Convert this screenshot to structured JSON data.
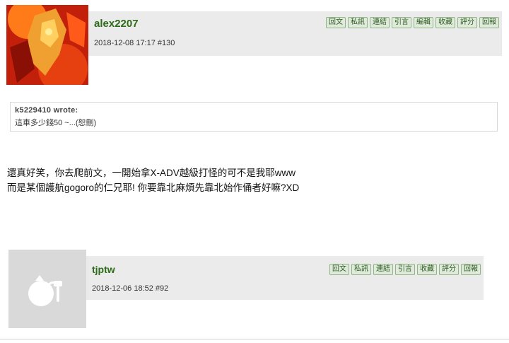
{
  "post1": {
    "username": "alex2207",
    "meta": "2018-12-08 17:17  #130",
    "buttons": [
      "回文",
      "私訊",
      "連結",
      "引言",
      "編輯",
      "收藏",
      "評分",
      "回報"
    ],
    "quote": {
      "author": "k5229410 wrote:",
      "text": "這車多少錢50 ~...(恕刪)"
    },
    "body_lines": [
      "還真好笑，你去爬前文，一開始拿X-ADV越級打怪的可不是我耶www",
      "而是某個護航gogoro的仁兄耶! 你要靠北麻煩先靠北始作俑者好嘛?XD"
    ]
  },
  "post2": {
    "username": "tjptw",
    "meta": "2018-12-06 18:52  #92",
    "buttons": [
      "回文",
      "私訊",
      "連結",
      "引言",
      "收藏",
      "評分",
      "回報"
    ]
  },
  "colors": {
    "username": "#2c6b18",
    "button_bg": "#dfeadb",
    "header_bg": "#ebebeb"
  }
}
